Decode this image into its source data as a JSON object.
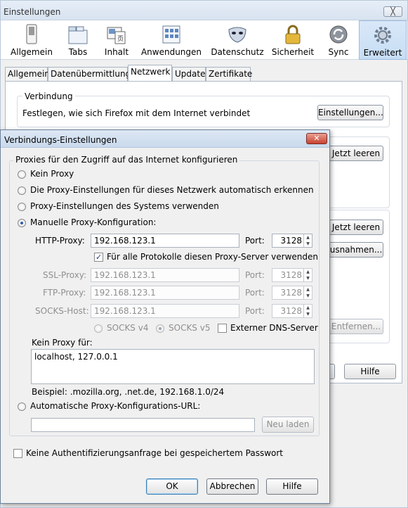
{
  "outer": {
    "title": "Einstellungen",
    "close": "╳",
    "toolbar": [
      {
        "label": "Allgemein",
        "icon": "switch-icon"
      },
      {
        "label": "Tabs",
        "icon": "tabs-icon"
      },
      {
        "label": "Inhalt",
        "icon": "content-icon"
      },
      {
        "label": "Anwendungen",
        "icon": "applications-icon"
      },
      {
        "label": "Datenschutz",
        "icon": "mask-icon"
      },
      {
        "label": "Sicherheit",
        "icon": "lock-icon"
      },
      {
        "label": "Sync",
        "icon": "sync-icon"
      },
      {
        "label": "Erweitert",
        "icon": "gear-icon"
      }
    ],
    "tabs": [
      "Allgemein",
      "Datenübermittlung",
      "Netzwerk",
      "Update",
      "Zertifikate"
    ],
    "connection": {
      "legend": "Verbindung",
      "desc": "Festlegen, wie sich Firefox mit dem Internet verbindet",
      "button": "Einstellungen..."
    },
    "partial_buttons": {
      "clear1": "Jetzt leeren",
      "clear2": "Jetzt leeren",
      "exceptions": "usnahmen...",
      "remove": "Entfernen...",
      "help": "Hilfe"
    }
  },
  "dialog": {
    "title": "Verbindungs-Einstellungen",
    "close": "✕",
    "legend": "Proxies für den Zugriff auf das Internet konfigurieren",
    "options": {
      "none": "Kein Proxy",
      "auto_detect": "Die Proxy-Einstellungen für dieses Netzwerk automatisch erkennen",
      "system": "Proxy-Einstellungen des Systems verwenden",
      "manual": "Manuelle Proxy-Konfiguration:"
    },
    "http": {
      "label": "HTTP-Proxy:",
      "value": "192.168.123.1",
      "port_label": "Port:",
      "port": "3128"
    },
    "all_protocols": "Für alle Protokolle diesen Proxy-Server verwenden",
    "ssl": {
      "label": "SSL-Proxy:",
      "value": "192.168.123.1",
      "port_label": "Port:",
      "port": "3128"
    },
    "ftp": {
      "label": "FTP-Proxy:",
      "value": "192.168.123.1",
      "port_label": "Port:",
      "port": "3128"
    },
    "socks": {
      "label": "SOCKS-Host:",
      "value": "192.168.123.1",
      "port_label": "Port:",
      "port": "3128"
    },
    "socks_v4": "SOCKS v4",
    "socks_v5": "SOCKS v5",
    "remote_dns": "Externer DNS-Server",
    "no_proxy_label": "Kein Proxy für:",
    "no_proxy_value": "localhost, 127.0.0.1",
    "example": "Beispiel: .mozilla.org, .net.de, 192.168.1.0/24",
    "auto_url_label": "Automatische Proxy-Konfigurations-URL:",
    "auto_url_value": "",
    "reload": "Neu laden",
    "no_auth": "Keine Authentifizierungsanfrage bei gespeichertem Passwort",
    "ok": "OK",
    "cancel": "Abbrechen",
    "help": "Hilfe"
  }
}
